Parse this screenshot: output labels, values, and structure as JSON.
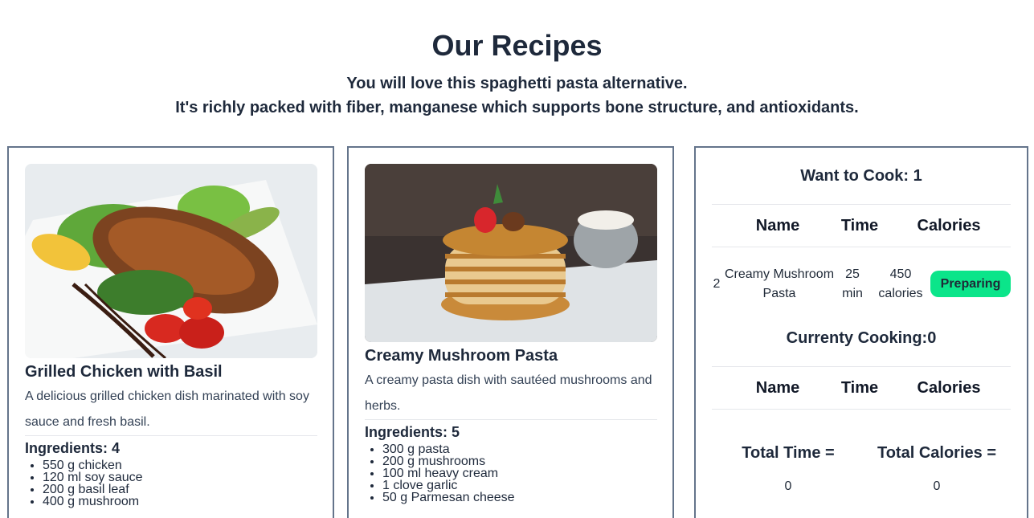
{
  "header": {
    "title": "Our Recipes",
    "tagline_1": "You will love this spaghetti pasta alternative.",
    "tagline_2": "It's richly packed with fiber, manganese which supports bone structure, and antioxidants."
  },
  "recipes": [
    {
      "name": "Grilled Chicken with Basil",
      "description": "A delicious grilled chicken dish marinated with soy sauce and fresh basil.",
      "ingredients_label": "Ingredients: 4",
      "ingredients": [
        "550 g chicken",
        "120 ml soy sauce",
        "200 g basil leaf",
        "400 g mushroom"
      ]
    },
    {
      "name": "Creamy Mushroom Pasta",
      "description": "A creamy pasta dish with sautéed mushrooms and herbs.",
      "ingredients_label": "Ingredients: 5",
      "ingredients": [
        "300 g pasta",
        "200 g mushrooms",
        "100 ml heavy cream",
        "1 clove garlic",
        "50 g Parmesan cheese"
      ]
    }
  ],
  "cook_panel": {
    "want_title": "Want to Cook: 1",
    "columns": [
      "Name",
      "Time",
      "Calories"
    ],
    "want_rows": [
      {
        "index": "2",
        "name": "Creamy Mushroom Pasta",
        "time": "25 min",
        "calories": "450 calories",
        "action": "Preparing"
      }
    ],
    "current_title": "Currenty Cooking:0",
    "current_columns": [
      "Name",
      "Time",
      "Calories"
    ],
    "total_time_label": "Total Time =",
    "total_calories_label": "Total Calories =",
    "total_time": "0",
    "total_calories": "0"
  },
  "colors": {
    "accent": "#0be58a",
    "text": "#1e293b",
    "card_border": "#64748b"
  }
}
